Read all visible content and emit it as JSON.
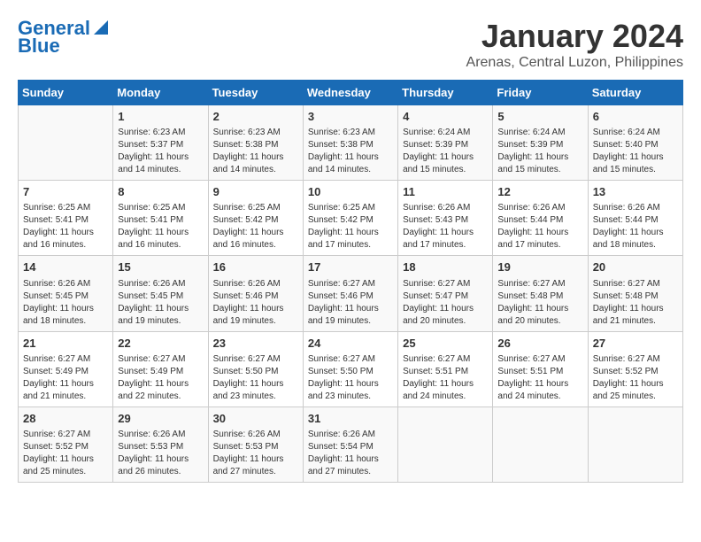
{
  "header": {
    "logo_line1": "General",
    "logo_line2": "Blue",
    "month": "January 2024",
    "location": "Arenas, Central Luzon, Philippines"
  },
  "days": [
    "Sunday",
    "Monday",
    "Tuesday",
    "Wednesday",
    "Thursday",
    "Friday",
    "Saturday"
  ],
  "weeks": [
    [
      {
        "num": "",
        "content": ""
      },
      {
        "num": "1",
        "content": "Sunrise: 6:23 AM\nSunset: 5:37 PM\nDaylight: 11 hours and 14 minutes."
      },
      {
        "num": "2",
        "content": "Sunrise: 6:23 AM\nSunset: 5:38 PM\nDaylight: 11 hours and 14 minutes."
      },
      {
        "num": "3",
        "content": "Sunrise: 6:23 AM\nSunset: 5:38 PM\nDaylight: 11 hours and 14 minutes."
      },
      {
        "num": "4",
        "content": "Sunrise: 6:24 AM\nSunset: 5:39 PM\nDaylight: 11 hours and 15 minutes."
      },
      {
        "num": "5",
        "content": "Sunrise: 6:24 AM\nSunset: 5:39 PM\nDaylight: 11 hours and 15 minutes."
      },
      {
        "num": "6",
        "content": "Sunrise: 6:24 AM\nSunset: 5:40 PM\nDaylight: 11 hours and 15 minutes."
      }
    ],
    [
      {
        "num": "7",
        "content": "Sunrise: 6:25 AM\nSunset: 5:41 PM\nDaylight: 11 hours and 16 minutes."
      },
      {
        "num": "8",
        "content": "Sunrise: 6:25 AM\nSunset: 5:41 PM\nDaylight: 11 hours and 16 minutes."
      },
      {
        "num": "9",
        "content": "Sunrise: 6:25 AM\nSunset: 5:42 PM\nDaylight: 11 hours and 16 minutes."
      },
      {
        "num": "10",
        "content": "Sunrise: 6:25 AM\nSunset: 5:42 PM\nDaylight: 11 hours and 17 minutes."
      },
      {
        "num": "11",
        "content": "Sunrise: 6:26 AM\nSunset: 5:43 PM\nDaylight: 11 hours and 17 minutes."
      },
      {
        "num": "12",
        "content": "Sunrise: 6:26 AM\nSunset: 5:44 PM\nDaylight: 11 hours and 17 minutes."
      },
      {
        "num": "13",
        "content": "Sunrise: 6:26 AM\nSunset: 5:44 PM\nDaylight: 11 hours and 18 minutes."
      }
    ],
    [
      {
        "num": "14",
        "content": "Sunrise: 6:26 AM\nSunset: 5:45 PM\nDaylight: 11 hours and 18 minutes."
      },
      {
        "num": "15",
        "content": "Sunrise: 6:26 AM\nSunset: 5:45 PM\nDaylight: 11 hours and 19 minutes."
      },
      {
        "num": "16",
        "content": "Sunrise: 6:26 AM\nSunset: 5:46 PM\nDaylight: 11 hours and 19 minutes."
      },
      {
        "num": "17",
        "content": "Sunrise: 6:27 AM\nSunset: 5:46 PM\nDaylight: 11 hours and 19 minutes."
      },
      {
        "num": "18",
        "content": "Sunrise: 6:27 AM\nSunset: 5:47 PM\nDaylight: 11 hours and 20 minutes."
      },
      {
        "num": "19",
        "content": "Sunrise: 6:27 AM\nSunset: 5:48 PM\nDaylight: 11 hours and 20 minutes."
      },
      {
        "num": "20",
        "content": "Sunrise: 6:27 AM\nSunset: 5:48 PM\nDaylight: 11 hours and 21 minutes."
      }
    ],
    [
      {
        "num": "21",
        "content": "Sunrise: 6:27 AM\nSunset: 5:49 PM\nDaylight: 11 hours and 21 minutes."
      },
      {
        "num": "22",
        "content": "Sunrise: 6:27 AM\nSunset: 5:49 PM\nDaylight: 11 hours and 22 minutes."
      },
      {
        "num": "23",
        "content": "Sunrise: 6:27 AM\nSunset: 5:50 PM\nDaylight: 11 hours and 23 minutes."
      },
      {
        "num": "24",
        "content": "Sunrise: 6:27 AM\nSunset: 5:50 PM\nDaylight: 11 hours and 23 minutes."
      },
      {
        "num": "25",
        "content": "Sunrise: 6:27 AM\nSunset: 5:51 PM\nDaylight: 11 hours and 24 minutes."
      },
      {
        "num": "26",
        "content": "Sunrise: 6:27 AM\nSunset: 5:51 PM\nDaylight: 11 hours and 24 minutes."
      },
      {
        "num": "27",
        "content": "Sunrise: 6:27 AM\nSunset: 5:52 PM\nDaylight: 11 hours and 25 minutes."
      }
    ],
    [
      {
        "num": "28",
        "content": "Sunrise: 6:27 AM\nSunset: 5:52 PM\nDaylight: 11 hours and 25 minutes."
      },
      {
        "num": "29",
        "content": "Sunrise: 6:26 AM\nSunset: 5:53 PM\nDaylight: 11 hours and 26 minutes."
      },
      {
        "num": "30",
        "content": "Sunrise: 6:26 AM\nSunset: 5:53 PM\nDaylight: 11 hours and 27 minutes."
      },
      {
        "num": "31",
        "content": "Sunrise: 6:26 AM\nSunset: 5:54 PM\nDaylight: 11 hours and 27 minutes."
      },
      {
        "num": "",
        "content": ""
      },
      {
        "num": "",
        "content": ""
      },
      {
        "num": "",
        "content": ""
      }
    ]
  ]
}
